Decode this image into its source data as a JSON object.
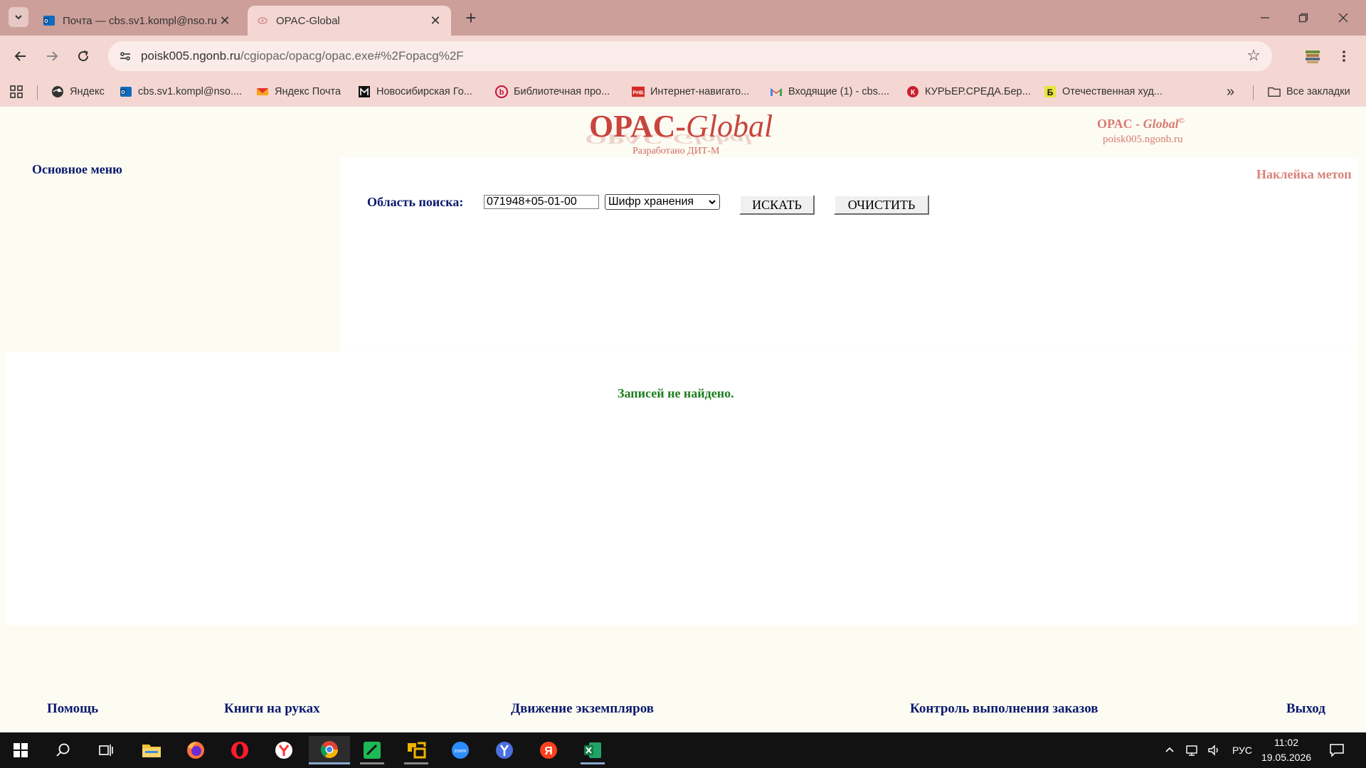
{
  "browser": {
    "tabs": [
      {
        "title": "Почта — cbs.sv1.kompl@nso.ru",
        "icon": "outlook-icon",
        "active": false
      },
      {
        "title": "OPAC-Global",
        "icon": "opac-favicon",
        "active": true
      }
    ],
    "url_host": "poisk005.ngonb.ru",
    "url_path": "/cgiopac/opacg/opac.exe#%2Fopacg%2F",
    "bookmarks": [
      {
        "label": "Яндекс",
        "icon": "yandex-globe-icon"
      },
      {
        "label": "cbs.sv1.kompl@nso....",
        "icon": "outlook-icon"
      },
      {
        "label": "Яндекс Почта",
        "icon": "yandex-mail-icon"
      },
      {
        "label": "Новосибирская Го...",
        "icon": "library-logo-icon"
      },
      {
        "label": "Библиотечная про...",
        "icon": "b-circle-icon"
      },
      {
        "label": "Интернет-навигато...",
        "icon": "rnb-icon"
      },
      {
        "label": "Входящие (1) - cbs....",
        "icon": "gmail-icon"
      },
      {
        "label": "КУРЬЕР.СРЕДА.Бер...",
        "icon": "k-circle-icon"
      },
      {
        "label": "Отечественная худ...",
        "icon": "b-square-icon"
      }
    ],
    "all_bookmarks": "Все закладки",
    "more_glyph": "»"
  },
  "header": {
    "logo_opac": "OPAC-",
    "logo_global": "Global",
    "developer": "Разработано ДИТ-М",
    "brand_left": "OPAC - ",
    "brand_global": "Global",
    "brand_copy": "©",
    "brand_host": "poisk005.ngonb.ru"
  },
  "sidebar": {
    "title": "Основное меню"
  },
  "search": {
    "sticker": "Наклейка метоп",
    "label": "Область поиска:",
    "query": "071948+05-01-00",
    "field": "Шифр хранения",
    "search_button": "ИСКАТЬ",
    "clear_button": "ОЧИСТИТЬ"
  },
  "results": {
    "message": "Записей не найдено."
  },
  "footer": {
    "links": [
      "Помощь",
      "Книги на руках",
      "Движение экземпляров",
      "Контроль выполнения заказов",
      "Выход"
    ]
  },
  "taskbar": {
    "lang": "РУС",
    "time": "11:02",
    "date": "19.05.2026",
    "apps": [
      "start-icon",
      "search-icon",
      "task-view-icon",
      "file-explorer-icon",
      "firefox-icon",
      "opera-icon",
      "yandex-browser-icon",
      "chrome-icon",
      "green-app-icon",
      "yellow-app-icon",
      "zoom-icon",
      "yandex-y-icon",
      "yandex-ya-icon",
      "excel-icon"
    ]
  },
  "colors": {
    "chrome_dark": "#cd9f9a",
    "chrome_light": "#f4d7d2",
    "page_bg": "#fdfcf3",
    "navy": "#0b1a6e",
    "logo_red": "#c8453e",
    "success_green": "#1e7d1e"
  }
}
